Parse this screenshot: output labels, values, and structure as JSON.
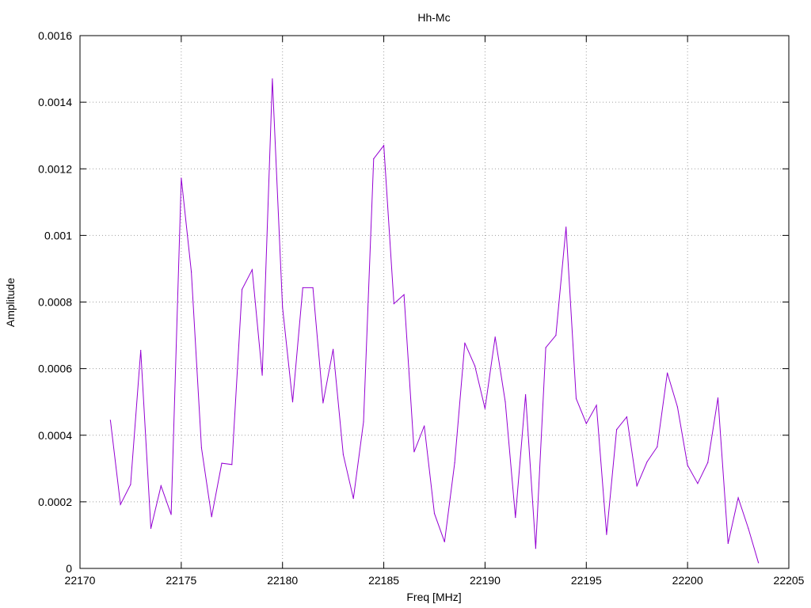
{
  "chart_data": {
    "type": "line",
    "title": "Hh-Mc",
    "xlabel": "Freq [MHz]",
    "ylabel": "Amplitude",
    "xlim": [
      22170,
      22205
    ],
    "ylim": [
      0,
      0.0016
    ],
    "x_ticks": [
      "22170",
      "22175",
      "22180",
      "22185",
      "22190",
      "22195",
      "22200",
      "22205"
    ],
    "y_ticks": [
      "0",
      "0.0002",
      "0.0004",
      "0.0006",
      "0.0008",
      "0.001",
      "0.0012",
      "0.0014",
      "0.0016"
    ],
    "grid": true,
    "series": [
      {
        "color": "#9400d3",
        "x": [
          22171.5,
          22172,
          22172.5,
          22173,
          22173.5,
          22174,
          22174.5,
          22175,
          22175.5,
          22176,
          22176.5,
          22177,
          22177.5,
          22178,
          22178.5,
          22179,
          22179.5,
          22180,
          22180.5,
          22181,
          22181.5,
          22182,
          22182.5,
          22183,
          22183.5,
          22184,
          22184.5,
          22185,
          22185.5,
          22186,
          22186.5,
          22187,
          22187.5,
          22188,
          22188.5,
          22189,
          22189.5,
          22190,
          22190.5,
          22191,
          22191.5,
          22192,
          22192.5,
          22193,
          22193.5,
          22194,
          22194.5,
          22195,
          22195.5,
          22196,
          22196.5,
          22197,
          22197.5,
          22198,
          22198.5,
          22199,
          22199.5,
          22200,
          22200.5,
          22201,
          22201.5,
          22202,
          22202.5,
          22203,
          22203.5
        ],
        "y": [
          0.000445,
          0.000192,
          0.000252,
          0.000655,
          0.00012,
          0.000248,
          0.000162,
          0.001172,
          0.00089,
          0.000362,
          0.000155,
          0.000316,
          0.000312,
          0.000838,
          0.000897,
          0.00058,
          0.00147,
          0.000785,
          0.0005,
          0.000843,
          0.000843,
          0.000497,
          0.000658,
          0.000342,
          0.00021,
          0.00044,
          0.00123,
          0.00127,
          0.000795,
          0.000822,
          0.00035,
          0.000428,
          0.000165,
          8e-05,
          0.000317,
          0.000677,
          0.000608,
          0.00048,
          0.000695,
          0.0005,
          0.000153,
          0.000522,
          6e-05,
          0.000663,
          0.0007,
          0.001025,
          0.00051,
          0.000435,
          0.00049,
          0.000102,
          0.000417,
          0.000455,
          0.000248,
          0.00032,
          0.000365,
          0.000587,
          0.000485,
          0.00031,
          0.000255,
          0.000318,
          0.000512,
          7.5e-05,
          0.000212,
          0.00012,
          1.7e-05
        ]
      }
    ]
  }
}
